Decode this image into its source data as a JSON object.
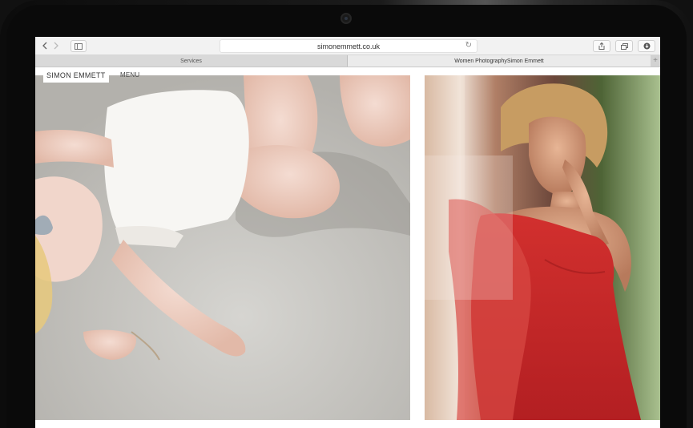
{
  "browser": {
    "url": "simonemmett.co.uk",
    "tabs": [
      {
        "label": "Services",
        "active": false
      },
      {
        "label": "Women PhotographySimon Emmett",
        "active": true
      }
    ],
    "icons": {
      "back": "chevron-left-icon",
      "forward": "chevron-right-icon",
      "sidebar": "sidebar-icon",
      "reload": "reload-icon",
      "share": "share-icon",
      "tabs": "tabs-icon",
      "download": "download-icon",
      "new_tab": "plus-icon"
    }
  },
  "site": {
    "logo": "SIMON EMMETT",
    "menu_label": "MENU"
  },
  "colors": {
    "device": "#111111",
    "accent_red": "#c42a2a"
  }
}
